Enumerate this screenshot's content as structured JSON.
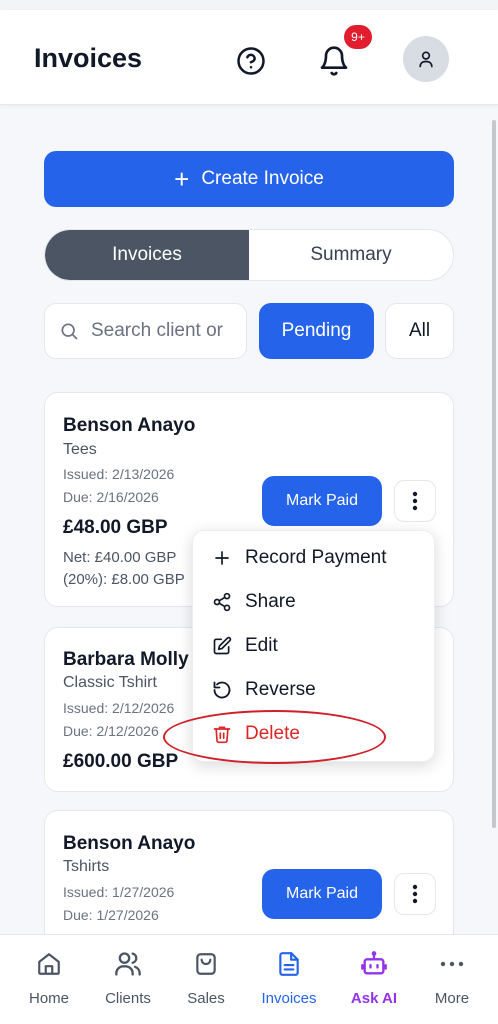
{
  "header": {
    "title": "Invoices",
    "notification_badge": "9+"
  },
  "actions": {
    "create_label": "Create Invoice"
  },
  "tabs": [
    {
      "label": "Invoices",
      "active": true
    },
    {
      "label": "Summary",
      "active": false
    }
  ],
  "filters": {
    "search_placeholder": "Search client or",
    "pending_label": "Pending",
    "all_label": "All"
  },
  "invoices": [
    {
      "client": "Benson Anayo",
      "product": "Tees",
      "issued": "Issued: 2/13/2026",
      "due": "Due: 2/16/2026",
      "amount": "£48.00 GBP",
      "net": "Net: £40.00 GBP",
      "tax": "(20%): £8.00 GBP",
      "action_label": "Mark Paid"
    },
    {
      "client": "Barbara Molly",
      "product": "Classic Tshirt",
      "issued": "Issued: 2/12/2026",
      "due": "Due: 2/12/2026",
      "amount": "£600.00 GBP"
    },
    {
      "client": "Benson Anayo",
      "product": "Tshirts",
      "issued": "Issued: 1/27/2026",
      "due": "Due: 1/27/2026",
      "action_label": "Mark Paid"
    }
  ],
  "context_menu": {
    "items": [
      {
        "label": "Record Payment",
        "icon": "plus-icon"
      },
      {
        "label": "Share",
        "icon": "share-icon"
      },
      {
        "label": "Edit",
        "icon": "edit-icon"
      },
      {
        "label": "Reverse",
        "icon": "undo-icon"
      },
      {
        "label": "Delete",
        "icon": "trash-icon",
        "color": "#dc2626"
      }
    ]
  },
  "bottom_nav": [
    {
      "label": "Home",
      "icon": "home-icon"
    },
    {
      "label": "Clients",
      "icon": "users-icon"
    },
    {
      "label": "Sales",
      "icon": "shopping-bag-icon"
    },
    {
      "label": "Invoices",
      "icon": "document-icon",
      "active": true
    },
    {
      "label": "Ask AI",
      "icon": "robot-icon"
    },
    {
      "label": "More",
      "icon": "more-icon"
    }
  ],
  "colors": {
    "primary": "#2563eb",
    "danger": "#dc2626",
    "ai_accent": "#9333ea",
    "segment_active": "#4b5563"
  }
}
